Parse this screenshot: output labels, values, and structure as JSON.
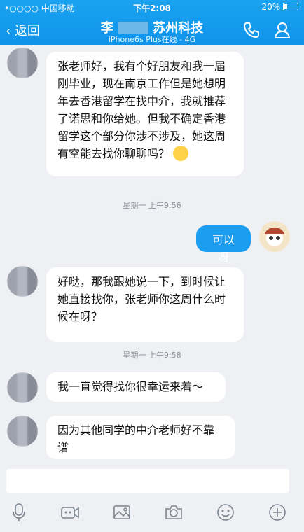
{
  "status_bar": {
    "carrier": "•○○○○ 中国移动",
    "time": "下午2:08",
    "battery": "20%"
  },
  "header": {
    "back_label": "返回",
    "title_prefix": "李",
    "title_suffix": "苏州科技",
    "subtitle": "iPhone6s Plus在线 - 4G"
  },
  "messages": [
    {
      "text": "张老师好，我有个好朋友和我一届刚毕业，现在南京工作但是她想明年去香港留学在找中介，我就推荐了诺思和你给她。但我不确定香港留学这个部分你涉不涉及，她这周有空能去找你聊聊吗？"
    },
    {
      "text": "星期一 上午9:56"
    },
    {
      "text": "可以呀"
    },
    {
      "text": "好哒，那我跟她说一下，到时候让她直接找你，张老师你这周什么时候在呀？"
    },
    {
      "text": "星期一 上午9:58"
    },
    {
      "text": "我一直觉得找你很幸运来着～"
    },
    {
      "text": "因为其他同学的中介老师好不靠谱"
    }
  ],
  "icons": {
    "phone": "phone-icon",
    "contact": "person-icon",
    "mic": "mic-icon",
    "video": "video-icon",
    "image": "image-icon",
    "camera": "camera-icon",
    "emoji": "emoji-icon",
    "add": "add-icon"
  },
  "colors": {
    "header": "#1aa3f0",
    "my_bubble": "#1b9df0",
    "background": "#eef0f3"
  }
}
